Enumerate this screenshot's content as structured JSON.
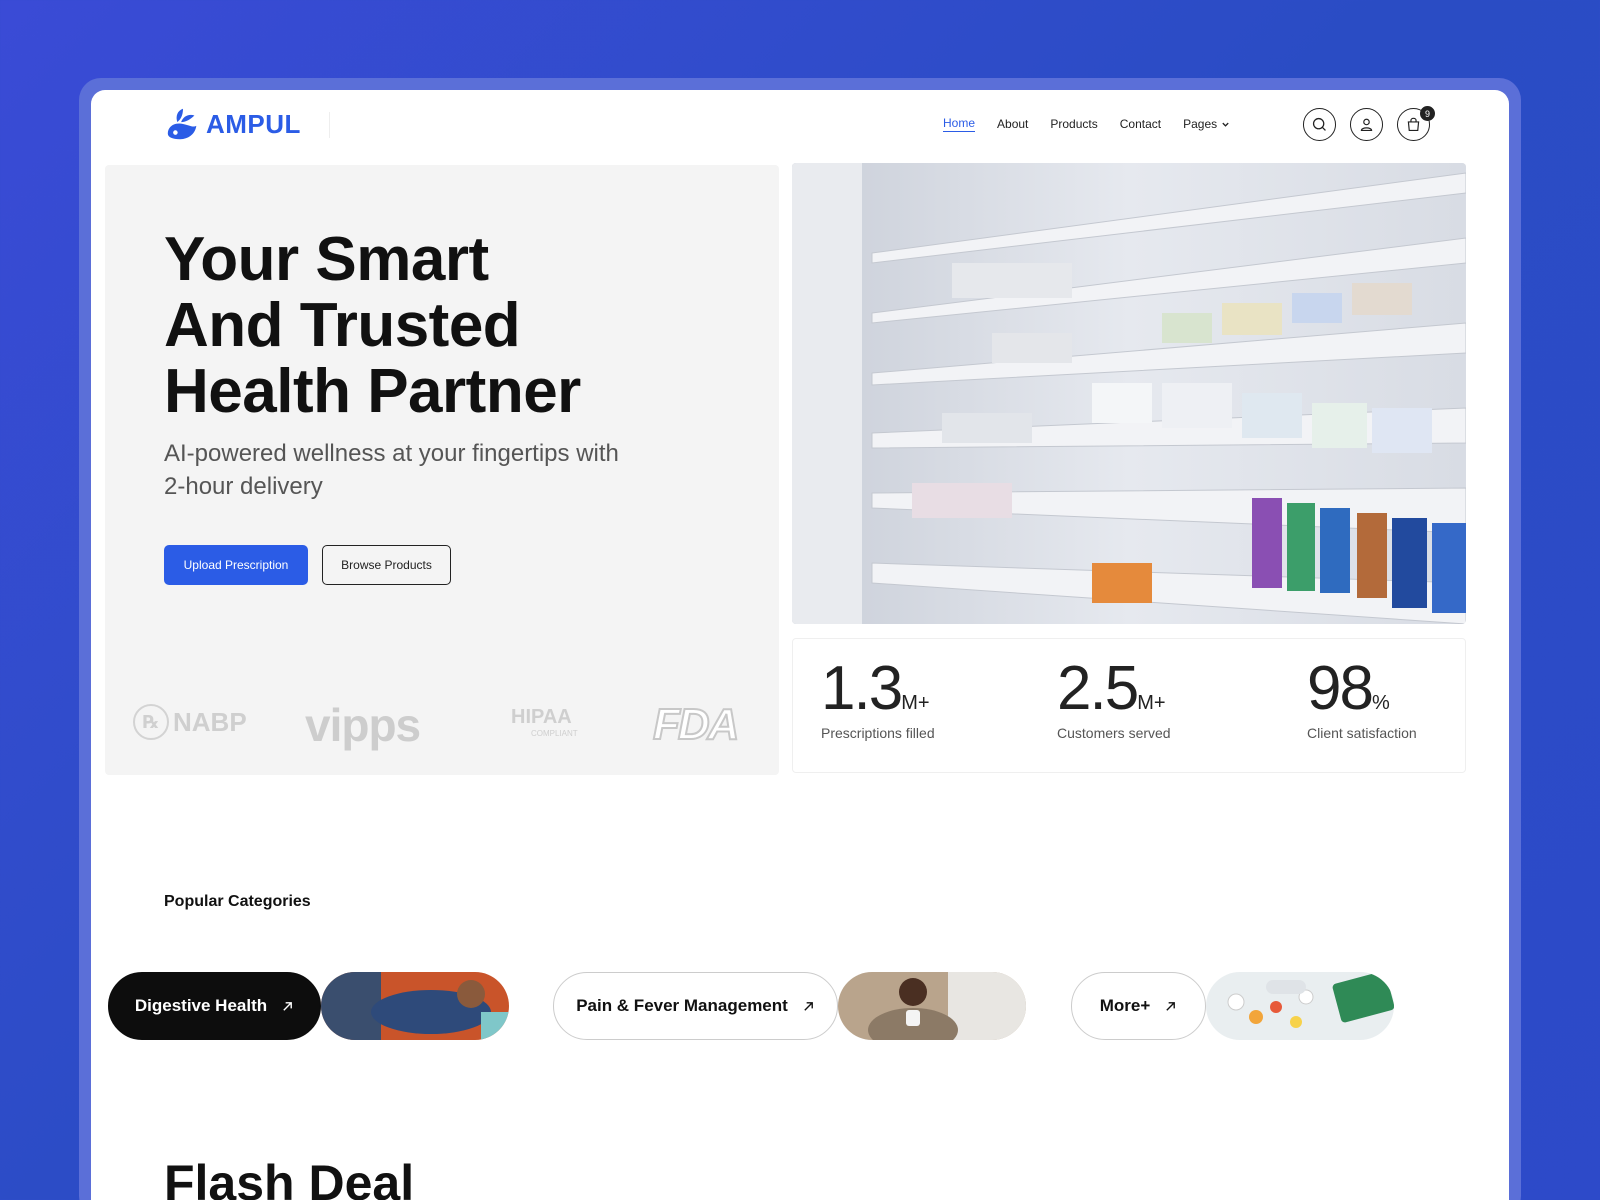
{
  "brand": {
    "name": "AMPUL",
    "color": "#2b5ce6"
  },
  "nav": {
    "items": [
      {
        "label": "Home",
        "active": true
      },
      {
        "label": "About"
      },
      {
        "label": "Products"
      },
      {
        "label": "Contact"
      },
      {
        "label": "Pages"
      }
    ],
    "cart_count": "9",
    "icons": [
      "search-icon",
      "user-icon",
      "bag-icon"
    ]
  },
  "hero": {
    "title_lines": [
      "Your Smart",
      "And Trusted",
      "Health Partner"
    ],
    "subtitle": "AI-powered wellness at your fingertips with 2-hour delivery",
    "primary_button": "Upload Prescription",
    "secondary_button": "Browse Products",
    "certifications": [
      "NABP",
      "vipps",
      "HIPAA",
      "FDA"
    ],
    "cert_small": "COMPLIANT"
  },
  "stats": [
    {
      "value": "1.3",
      "unit": "M+",
      "label": "Prescriptions filled"
    },
    {
      "value": "2.5",
      "unit": "M+",
      "label": "Customers served"
    },
    {
      "value": "98",
      "unit": "%",
      "label": "Client satisfaction"
    }
  ],
  "categories": {
    "heading": "Popular Categories",
    "items": [
      {
        "label": "Digestive Health"
      },
      {
        "label": "Pain & Fever Management"
      },
      {
        "label": "More+"
      }
    ]
  },
  "flash": {
    "title": "Flash Deal"
  }
}
